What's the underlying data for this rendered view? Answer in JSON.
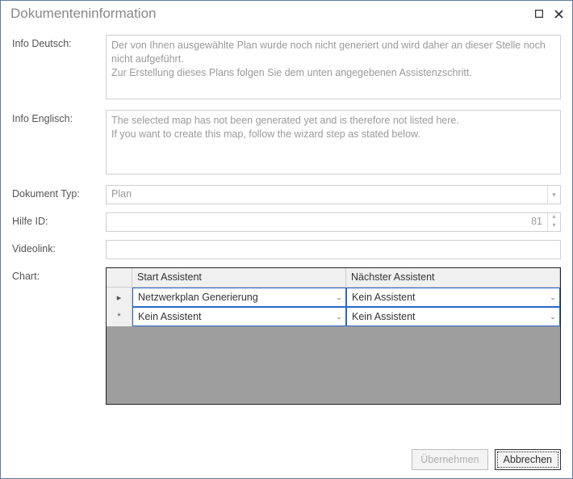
{
  "window": {
    "title": "Dokumenteninformation"
  },
  "labels": {
    "info_de": "Info Deutsch:",
    "info_en": "Info Englisch:",
    "doc_type": "Dokument Typ:",
    "help_id": "Hilfe ID:",
    "videolink": "Videolink:",
    "chart": "Chart:"
  },
  "fields": {
    "info_de": "Der von Ihnen ausgewählte Plan wurde noch nicht generiert und wird daher an dieser Stelle noch nicht aufgeführt.\nZur Erstellung dieses Plans folgen Sie dem unten angegebenen Assistenzschritt.",
    "info_en": "The selected map has not been generated yet and is therefore not listed here.\nIf you want to create this map, follow the wizard step as stated below.",
    "doc_type": "Plan",
    "help_id": "81",
    "videolink": ""
  },
  "grid": {
    "col1": "Start Assistent",
    "col2": "Nächster Assistent",
    "rows": [
      {
        "marker": "▸",
        "start": "Netzwerkplan Generierung",
        "next": "Kein Assistent"
      },
      {
        "marker": "*",
        "start": "Kein Assistent",
        "next": "Kein Assistent"
      }
    ]
  },
  "buttons": {
    "apply": "Übernehmen",
    "cancel": "Abbrechen"
  }
}
